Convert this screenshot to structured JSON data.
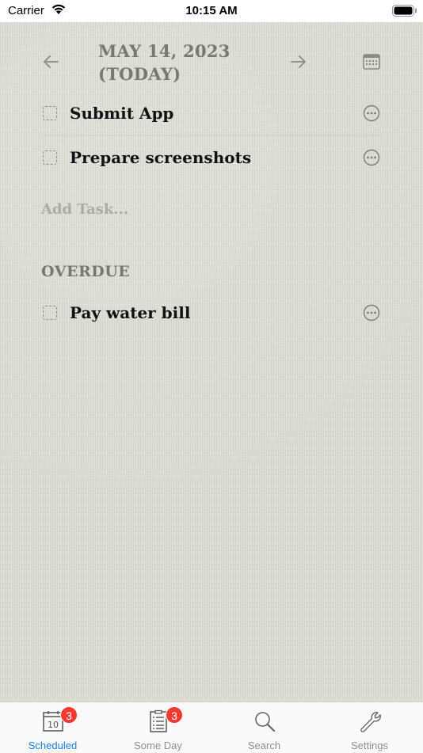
{
  "status_bar": {
    "carrier": "Carrier",
    "time": "10:15 AM"
  },
  "header": {
    "date_line1": "MAY 14, 2023",
    "date_line2": "(TODAY)",
    "prev_icon": "arrow-left-icon",
    "next_icon": "arrow-right-icon",
    "calendar_icon": "calendar-icon"
  },
  "tasks": [
    {
      "title": "Submit App",
      "done": false
    },
    {
      "title": "Prepare screenshots",
      "done": false
    }
  ],
  "add_task_placeholder": "Add Task...",
  "overdue": {
    "header": "OVERDUE",
    "tasks": [
      {
        "title": "Pay water bill",
        "done": false
      }
    ]
  },
  "tab_bar": {
    "active": "Scheduled",
    "accent_color": "#1a7ee6",
    "badge_color": "#f23b30",
    "tabs": [
      {
        "label": "Scheduled",
        "icon": "calendar-day-icon",
        "badge": "3",
        "calendar_day": "10"
      },
      {
        "label": "Some Day",
        "icon": "checklist-icon",
        "badge": "3"
      },
      {
        "label": "Search",
        "icon": "search-icon"
      },
      {
        "label": "Settings",
        "icon": "wrench-icon"
      }
    ]
  }
}
